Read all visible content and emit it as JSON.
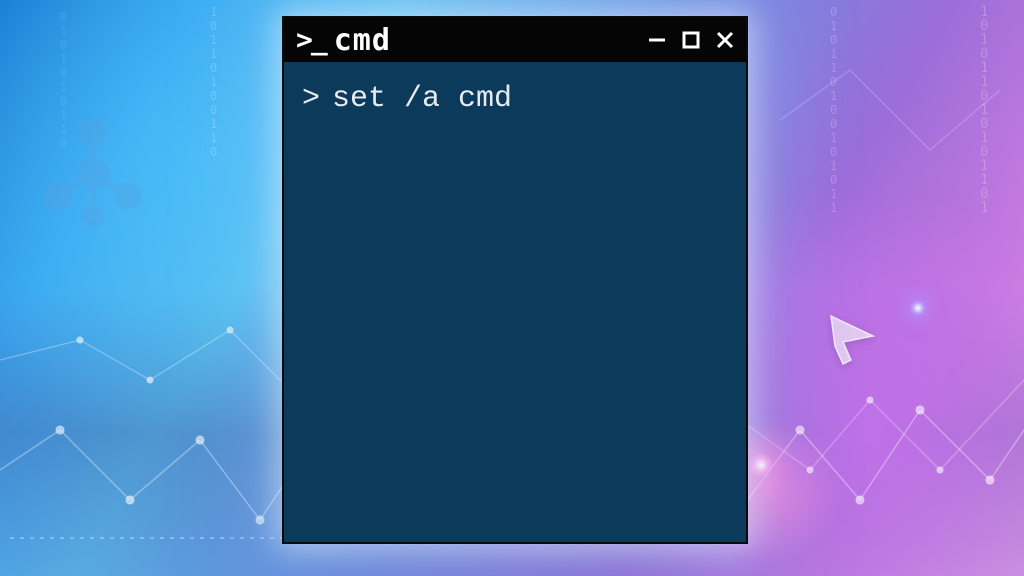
{
  "window": {
    "title": "cmd",
    "prompt_icon": ">_",
    "controls": {
      "minimize": "minimize",
      "maximize": "maximize",
      "close": "close"
    }
  },
  "terminal": {
    "lines": [
      {
        "prompt": ">",
        "command": "set /a cmd"
      }
    ]
  },
  "colors": {
    "terminal_bg": "#0c3a5a",
    "titlebar_bg": "#050505",
    "text": "#e6ecf2"
  }
}
